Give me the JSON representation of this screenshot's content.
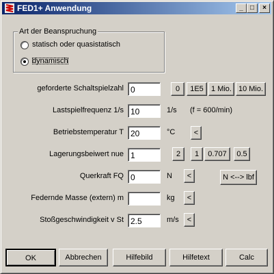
{
  "window": {
    "title": "FED1+ Anwendung"
  },
  "caption_buttons": {
    "minimize": "_",
    "maximize": "□",
    "close": "×"
  },
  "group": {
    "title": "Art der Beanspruchung",
    "options": [
      "statisch oder quasistatisch",
      "dynamisch"
    ],
    "selected": "dynamisch"
  },
  "fields": {
    "schaltspielzahl": {
      "label": "geforderte Schaltspielzahl",
      "value": "0"
    },
    "lastspielfrequenz": {
      "label": "Lastspielfrequenz 1/s",
      "value": "10",
      "unit": "1/s",
      "note": "(f = 600/min)"
    },
    "temperatur": {
      "label": "Betriebstemperatur T",
      "value": "20",
      "unit": "°C"
    },
    "lagerung": {
      "label": "Lagerungsbeiwert nue",
      "value": "1"
    },
    "querkraft": {
      "label": "Querkraft FQ",
      "value": "0",
      "unit": "N"
    },
    "masse": {
      "label": "Federnde Masse (extern) m",
      "value": "",
      "unit": "kg"
    },
    "stoss": {
      "label": "Stoßgeschwindigkeit v St",
      "value": "2.5",
      "unit": "m/s"
    }
  },
  "presets": {
    "schaltspiel": [
      "0",
      "1E5",
      "1 Mio.",
      "10 Mio."
    ],
    "lagerung": [
      "2",
      "1",
      "0.707",
      "0.5"
    ]
  },
  "arrow_label": "<",
  "convert_label": "N <--> lbf",
  "footer": [
    "OK",
    "Abbrechen",
    "Hilfebild",
    "Hilfetext",
    "Calc"
  ]
}
